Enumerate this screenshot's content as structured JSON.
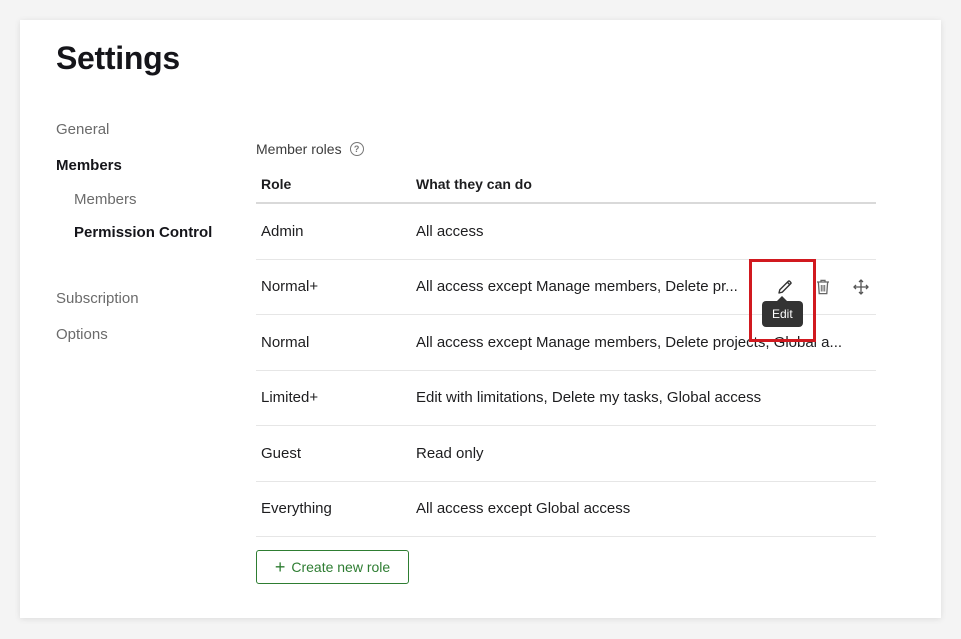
{
  "page": {
    "title": "Settings"
  },
  "sidebar": {
    "items": [
      {
        "label": "General"
      },
      {
        "label": "Members"
      },
      {
        "label": "Members"
      },
      {
        "label": "Permission Control"
      },
      {
        "label": "Subscription"
      },
      {
        "label": "Options"
      }
    ]
  },
  "section": {
    "label": "Member roles",
    "help_icon": "help-circle-icon"
  },
  "table": {
    "headers": {
      "role": "Role",
      "desc": "What they can do"
    },
    "rows": [
      {
        "role": "Admin",
        "desc": "All access"
      },
      {
        "role": "Normal+",
        "desc": "All access except Manage members, Delete pr..."
      },
      {
        "role": "Normal",
        "desc": "All access except Manage members, Delete projects, Global a..."
      },
      {
        "role": "Limited+",
        "desc": "Edit with limitations, Delete my tasks, Global access"
      },
      {
        "role": "Guest",
        "desc": "Read only"
      },
      {
        "role": "Everything",
        "desc": "All access except Global access"
      }
    ],
    "row_actions": {
      "icons": [
        "pencil-icon",
        "trash-icon",
        "move-icon"
      ]
    }
  },
  "tooltip": {
    "text": "Edit"
  },
  "create_button": {
    "label": "Create new role"
  },
  "colors": {
    "accent_green": "#2e7d32",
    "highlight_red": "#d1191f",
    "tooltip_bg": "#333333"
  }
}
